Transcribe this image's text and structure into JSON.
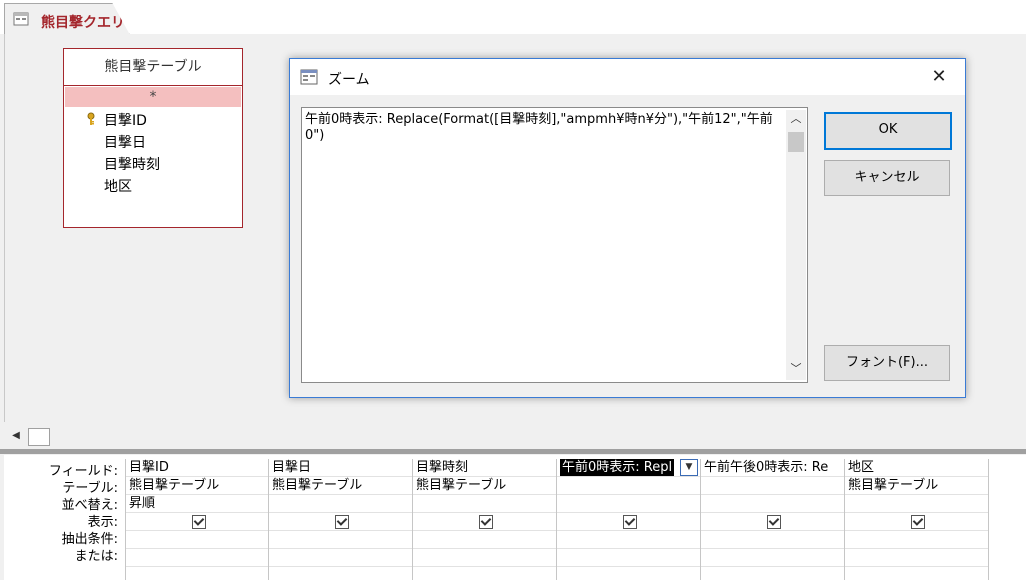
{
  "tab": {
    "title": "熊目撃クエリ"
  },
  "table_box": {
    "title": "熊目撃テーブル",
    "fields": [
      "*",
      "目撃ID",
      "目撃日",
      "目撃時刻",
      "地区"
    ]
  },
  "zoom_dialog": {
    "title": "ズーム",
    "close_glyph": "✕",
    "expression": "午前0時表示: Replace(Format([目撃時刻],\"ampmh¥時n¥分\"),\"午前12\",\"午前0\")",
    "ok_label": "OK",
    "cancel_label": "キャンセル",
    "font_label": "フォント(F)..."
  },
  "grid": {
    "row_labels": [
      "フィールド:",
      "テーブル:",
      "並べ替え:",
      "表示:",
      "抽出条件:",
      "または:"
    ],
    "columns": [
      {
        "field": "目撃ID",
        "table": "熊目撃テーブル",
        "sort": "昇順",
        "show": true
      },
      {
        "field": "目撃日",
        "table": "熊目撃テーブル",
        "sort": "",
        "show": true
      },
      {
        "field": "目撃時刻",
        "table": "熊目撃テーブル",
        "sort": "",
        "show": true
      },
      {
        "field": "午前0時表示: Repl",
        "table": "",
        "sort": "",
        "show": true
      },
      {
        "field": "午前午後0時表示: Re",
        "table": "",
        "sort": "",
        "show": true
      },
      {
        "field": "地区",
        "table": "熊目撃テーブル",
        "sort": "",
        "show": true
      }
    ]
  },
  "colors": {
    "accent": "#a4262c",
    "dialog_border": "#3a7bd5",
    "default_button": "#0078d7"
  }
}
